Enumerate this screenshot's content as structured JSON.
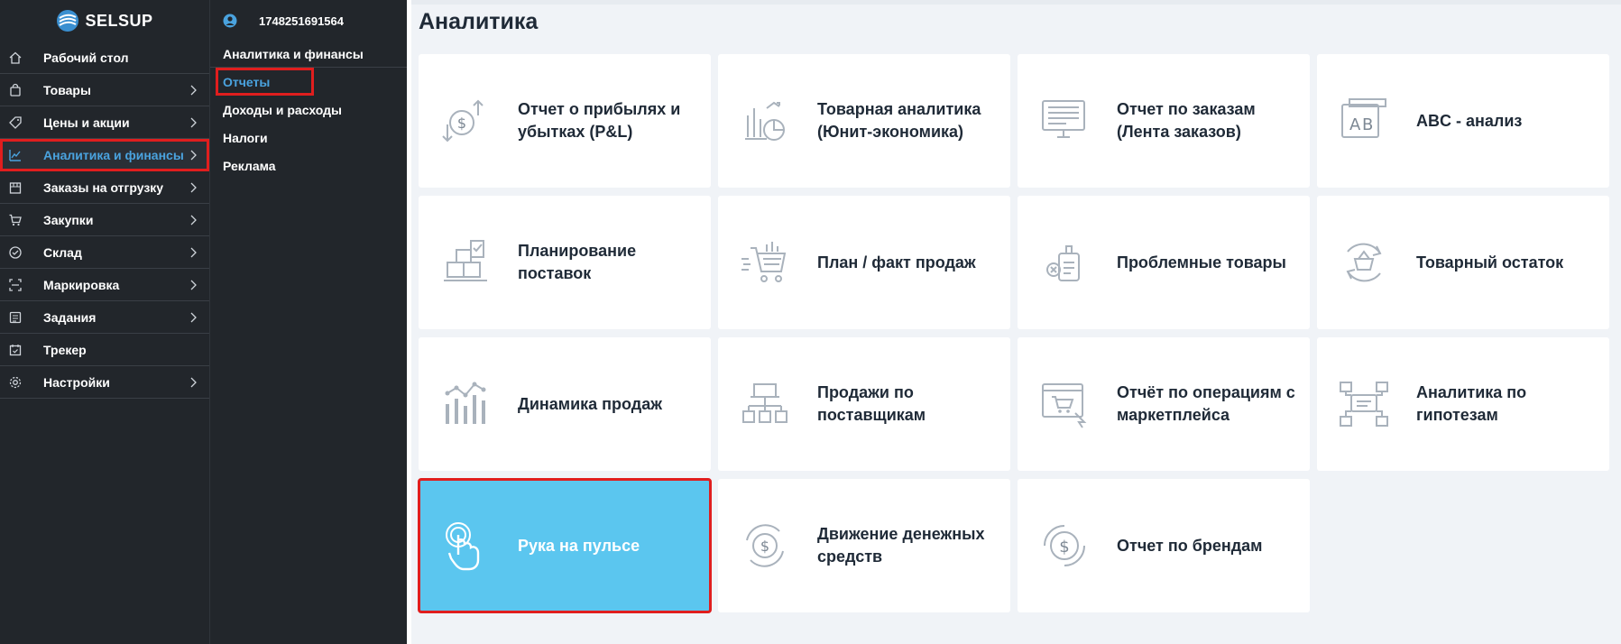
{
  "brand": {
    "name": "SELSUP",
    "accent": "#4aa3df",
    "highlight": "#5bc6ef",
    "alert": "#e01e1e"
  },
  "sidebar": {
    "items": [
      {
        "label": "Рабочий стол",
        "icon": "home-icon",
        "chevron": false
      },
      {
        "label": "Товары",
        "icon": "bag-icon",
        "chevron": true
      },
      {
        "label": "Цены и акции",
        "icon": "tag-icon",
        "chevron": true
      },
      {
        "label": "Аналитика и финансы",
        "icon": "chart-line-icon",
        "chevron": true,
        "active": true
      },
      {
        "label": "Заказы на отгрузку",
        "icon": "box-icon",
        "chevron": true
      },
      {
        "label": "Закупки",
        "icon": "cart-icon",
        "chevron": true
      },
      {
        "label": "Склад",
        "icon": "check-circle-icon",
        "chevron": true
      },
      {
        "label": "Маркировка",
        "icon": "scan-icon",
        "chevron": true
      },
      {
        "label": "Задания",
        "icon": "list-icon",
        "chevron": true
      },
      {
        "label": "Трекер",
        "icon": "calendar-check-icon",
        "chevron": false
      },
      {
        "label": "Настройки",
        "icon": "gear-icon",
        "chevron": true
      }
    ]
  },
  "subpanel": {
    "user_id": "1748251691564",
    "header": "Аналитика и финансы",
    "items": [
      {
        "label": "Отчеты",
        "active": true
      },
      {
        "label": "Доходы и расходы"
      },
      {
        "label": "Налоги"
      },
      {
        "label": "Реклама"
      }
    ]
  },
  "main": {
    "title": "Аналитика",
    "cards": [
      {
        "label": "Отчет о прибылях и убытках (P&L)",
        "icon": "profit-loss-icon"
      },
      {
        "label": "Товарная аналитика (Юнит-экономика)",
        "icon": "product-analytics-icon"
      },
      {
        "label": "Отчет по заказам (Лента заказов)",
        "icon": "orders-report-icon"
      },
      {
        "label": "ABC - анализ",
        "icon": "abc-analysis-icon"
      },
      {
        "label": "Планирование поставок",
        "icon": "supply-planning-icon"
      },
      {
        "label": "План / факт продаж",
        "icon": "sales-plan-icon"
      },
      {
        "label": "Проблемные товары",
        "icon": "problem-goods-icon"
      },
      {
        "label": "Товарный остаток",
        "icon": "stock-balance-icon"
      },
      {
        "label": "Динамика продаж",
        "icon": "sales-dynamics-icon"
      },
      {
        "label": "Продажи по поставщикам",
        "icon": "supplier-sales-icon"
      },
      {
        "label": "Отчёт по операциям с маркетплейса",
        "icon": "marketplace-operations-icon"
      },
      {
        "label": "Аналитика по гипотезам",
        "icon": "hypothesis-icon"
      },
      {
        "label": "Рука на пульсе",
        "icon": "hand-pulse-icon",
        "highlight": true
      },
      {
        "label": "Движение денежных средств",
        "icon": "cash-flow-icon"
      },
      {
        "label": "Отчет по брендам",
        "icon": "brand-report-icon"
      }
    ]
  }
}
